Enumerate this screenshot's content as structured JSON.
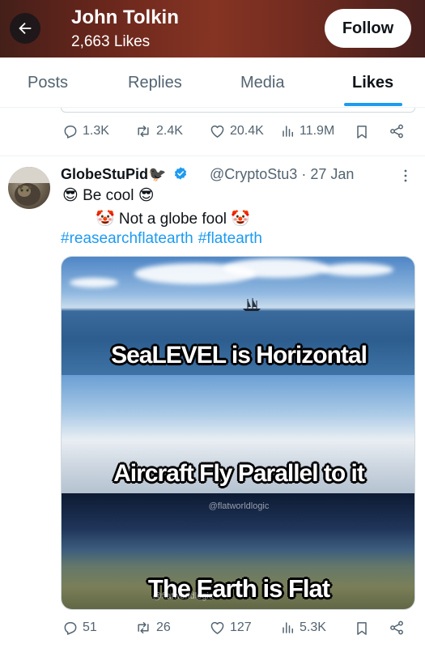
{
  "header": {
    "name": "John Tolkin",
    "likes": "2,663 Likes",
    "follow_label": "Follow"
  },
  "tabs": [
    {
      "label": "Posts",
      "active": false
    },
    {
      "label": "Replies",
      "active": false
    },
    {
      "label": "Media",
      "active": false
    },
    {
      "label": "Likes",
      "active": true
    }
  ],
  "prev_post_actions": {
    "replies": "1.3K",
    "reposts": "2.4K",
    "likes": "20.4K",
    "views": "11.9M"
  },
  "post": {
    "display_name": "GlobeStuPid🐦‍⬛",
    "handle_date": "@CryptoStu3 · 27 Jan",
    "line1": "😎 Be cool 😎",
    "line2": "🤡 Not a globe fool 🤡",
    "hashtags": [
      "#reasearchflatearth",
      "#flatearth"
    ],
    "media": {
      "caption_1": "SeaLEVEL is Horizontal",
      "caption_2": "Aircraft Fly Parallel to it",
      "caption_3": "The Earth is Flat",
      "watermark_1": "@flatworldlogic",
      "watermark_2": "@flatworldlogic"
    },
    "actions": {
      "replies": "51",
      "reposts": "26",
      "likes": "127",
      "views": "5.3K"
    }
  },
  "colors": {
    "accent": "#1d9bf0",
    "verified": "#1d9bf0",
    "secondary_text": "#536471"
  },
  "icons": [
    "back-arrow-icon",
    "reply-icon",
    "repost-icon",
    "like-icon",
    "views-icon",
    "bookmark-icon",
    "share-icon",
    "verified-icon",
    "more-icon"
  ]
}
